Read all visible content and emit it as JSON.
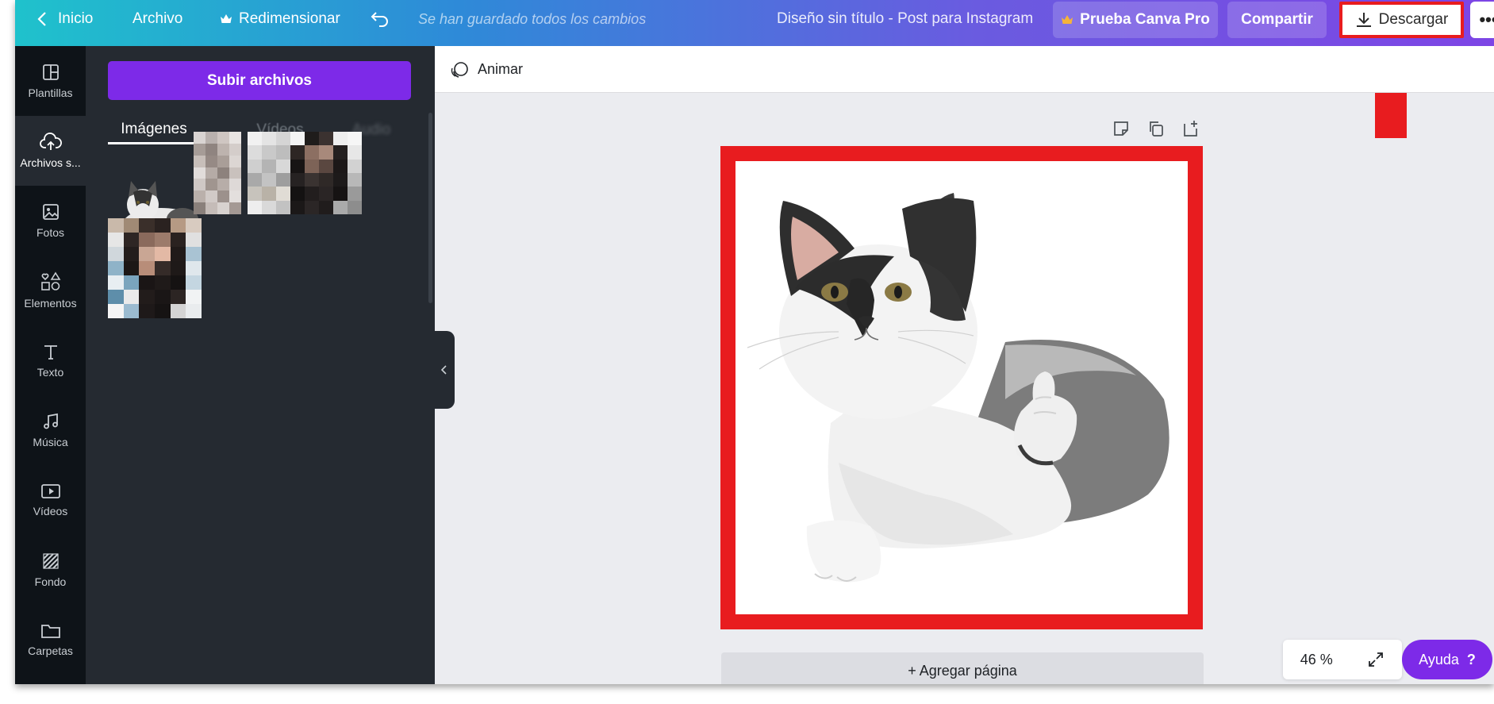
{
  "topbar": {
    "back_label": "Inicio",
    "file_label": "Archivo",
    "resize_label": "Redimensionar",
    "saved_status": "Se han guardado todos los cambios",
    "design_title": "Diseño sin título - Post para Instagram",
    "pro_label": "Prueba Canva Pro",
    "share_label": "Compartir",
    "download_label": "Descargar",
    "more_label": "•••"
  },
  "rail": {
    "items": [
      {
        "label": "Plantillas",
        "icon": "templates-icon"
      },
      {
        "label": "Archivos s...",
        "icon": "cloud-upload-icon"
      },
      {
        "label": "Fotos",
        "icon": "photo-icon"
      },
      {
        "label": "Elementos",
        "icon": "shapes-icon"
      },
      {
        "label": "Texto",
        "icon": "text-icon"
      },
      {
        "label": "Música",
        "icon": "music-icon"
      },
      {
        "label": "Vídeos",
        "icon": "video-icon"
      },
      {
        "label": "Fondo",
        "icon": "background-icon"
      },
      {
        "label": "Carpetas",
        "icon": "folder-icon"
      }
    ]
  },
  "panel": {
    "upload_label": "Subir archivos",
    "tabs": [
      {
        "label": "Imágenes"
      },
      {
        "label": "Vídeos"
      },
      {
        "label": "Audio"
      }
    ]
  },
  "canvas": {
    "animate_label": "Animar",
    "add_page_label": "+ Agregar página"
  },
  "footer": {
    "zoom": "46 %",
    "help_label": "Ayuda",
    "help_icon": "?"
  },
  "colors": {
    "accent": "#7d2ae8",
    "highlight": "#e81c1f"
  }
}
